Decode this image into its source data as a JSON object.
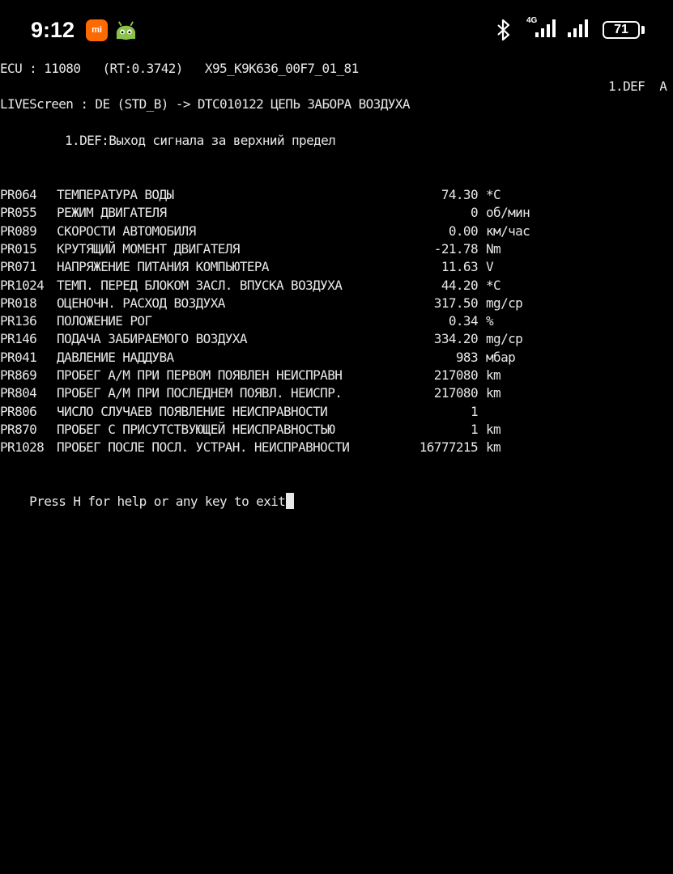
{
  "status_bar": {
    "time": "9:12",
    "mi_icon_label": "mi",
    "network_type": "4G",
    "battery": "71"
  },
  "header": {
    "ecu_line": "ECU : 11080   (RT:0.3742)   X95_K9K636_00F7_01_81",
    "screen_line": "Screen : DE (STD_B) -> DTC010122 ЦЕПЬ ЗАБОРА ВОЗДУХА",
    "screen_right": "1.DEF  A",
    "mode": "LIVE"
  },
  "def_line": "1.DEF:Выход сигнала за верхний предел",
  "params": [
    {
      "code": "PR064",
      "name": "ТЕМПЕРАТУРА ВОДЫ",
      "value": "74.30",
      "unit": "*C"
    },
    {
      "code": "PR055",
      "name": "РЕЖИМ ДВИГАТЕЛЯ",
      "value": "0",
      "unit": "об/мин"
    },
    {
      "code": "PR089",
      "name": "СКОРОСТИ АВТОМОБИЛЯ",
      "value": "0.00",
      "unit": "км/час"
    },
    {
      "code": "PR015",
      "name": "КРУТЯЩИЙ МОМЕНТ ДВИГАТЕЛЯ",
      "value": "-21.78",
      "unit": "Nm"
    },
    {
      "code": "PR071",
      "name": "НАПРЯЖЕНИЕ ПИТАНИЯ КОМПЬЮТЕРА",
      "value": "11.63",
      "unit": "V"
    },
    {
      "code": "PR1024",
      "name": "ТЕМП. ПЕРЕД БЛОКОМ ЗАСЛ. ВПУСКА ВОЗДУХА",
      "value": "44.20",
      "unit": "*C"
    },
    {
      "code": "PR018",
      "name": "ОЦЕНОЧН. РАСХОД ВОЗДУХА",
      "value": "317.50",
      "unit": "mg/cp"
    },
    {
      "code": "PR136",
      "name": "ПОЛОЖЕНИЕ РОГ",
      "value": "0.34",
      "unit": "%"
    },
    {
      "code": "PR146",
      "name": "ПОДАЧА ЗАБИРАЕМОГО ВОЗДУХА",
      "value": "334.20",
      "unit": "mg/cp"
    },
    {
      "code": "PR041",
      "name": "ДАВЛЕНИЕ НАДДУВА",
      "value": "983",
      "unit": "мбар"
    },
    {
      "code": "PR869",
      "name": "ПРОБЕГ А/М ПРИ ПЕРВОМ ПОЯВЛЕН НЕИСПРАВН",
      "value": "217080",
      "unit": "km"
    },
    {
      "code": "PR804",
      "name": "ПРОБЕГ А/М ПРИ ПОСЛЕДНЕМ ПОЯВЛ. НЕИСПР.",
      "value": "217080",
      "unit": "km"
    },
    {
      "code": "PR806",
      "name": "ЧИСЛО СЛУЧАЕВ ПОЯВЛЕНИЕ НЕИСПРАВНОСТИ",
      "value": "1",
      "unit": ""
    },
    {
      "code": "PR870",
      "name": "ПРОБЕГ С ПРИСУТСТВУЮЩЕЙ НЕИСПРАВНОСТЬЮ",
      "value": "1",
      "unit": "km"
    },
    {
      "code": "PR1028",
      "name": "ПРОБЕГ ПОСЛЕ ПОСЛ. УСТРАН. НЕИСПРАВНОСТИ",
      "value": "16777215",
      "unit": "km"
    }
  ],
  "prompt": "Press H for help or any key to exit"
}
